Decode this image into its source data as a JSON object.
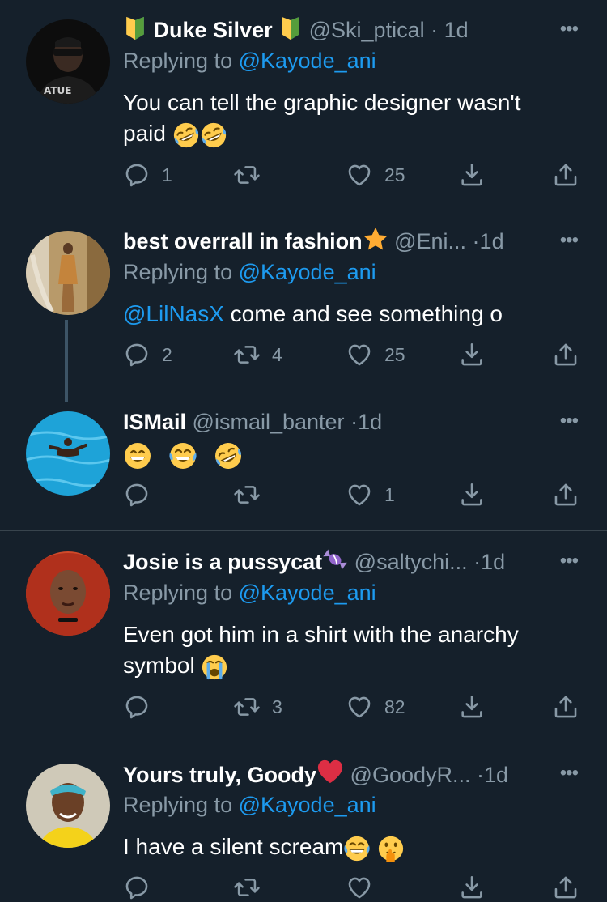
{
  "tweets": [
    {
      "name": "Duke Silver",
      "handle": "@Ski_ptical",
      "dot": "·",
      "time": "1d",
      "replying_prefix": "Replying to",
      "replying_to": "@Kayode_ani",
      "text": "You can tell the graphic designer wasn't",
      "text_line2": "paid",
      "reply_count": "1",
      "retweet_count": "",
      "like_count": "25",
      "emoji": [
        "rofl",
        "rofl"
      ]
    },
    {
      "name": "best overrall in fashion",
      "handle": "@Eni...",
      "dot": "·",
      "time": "1d",
      "replying_prefix": "Replying to",
      "replying_to": "@Kayode_ani",
      "mention": "@LilNasX",
      "text": " come and see something o",
      "reply_count": "2",
      "retweet_count": "4",
      "like_count": "25"
    },
    {
      "name": "ISMail",
      "handle": "@ismail_banter",
      "dot": "·",
      "time": "1d",
      "reply_count": "",
      "retweet_count": "",
      "like_count": "1",
      "emoji": [
        "grin",
        "joy",
        "rofl"
      ]
    },
    {
      "name": "Josie is a pussycat",
      "handle": "@saltychi...",
      "dot": "·",
      "time": "1d",
      "replying_prefix": "Replying to",
      "replying_to": "@Kayode_ani",
      "text": "Even got him in a shirt with the anarchy",
      "text_line2": "symbol",
      "reply_count": "",
      "retweet_count": "3",
      "like_count": "82"
    },
    {
      "name": "Yours truly, Goody",
      "handle": "@GoodyR...",
      "dot": "·",
      "time": "1d",
      "replying_prefix": "Replying to",
      "replying_to": "@Kayode_ani",
      "text": "I have a silent scream"
    }
  ],
  "more_label": "•••",
  "colors": {
    "background": "#15202b",
    "text": "#ffffff",
    "muted": "#8899a6",
    "link": "#1d9bf0",
    "divider": "#38444d"
  },
  "icons": [
    "reply-icon",
    "retweet-icon",
    "like-icon",
    "bookmark-icon",
    "share-icon",
    "more-icon"
  ]
}
